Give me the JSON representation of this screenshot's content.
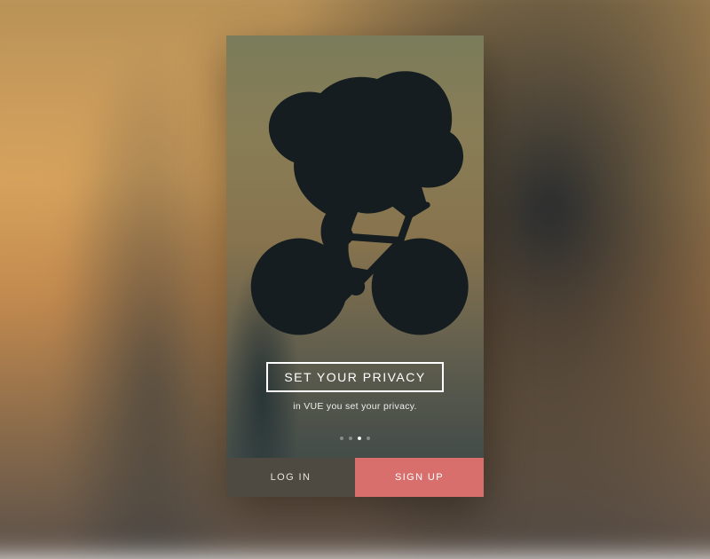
{
  "onboarding": {
    "headline": "SET YOUR PRIVACY",
    "subtitle": "in VUE you set your privacy.",
    "page_count": 4,
    "active_page_index": 2
  },
  "buttons": {
    "login": "LOG IN",
    "signup": "SIGN UP"
  },
  "colors": {
    "signup_bg": "#d86f6c",
    "login_bg": "#4e4a42"
  }
}
